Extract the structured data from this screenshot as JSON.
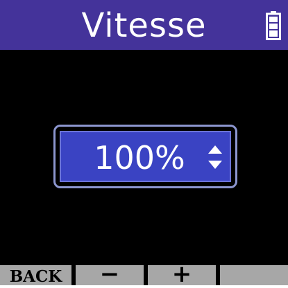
{
  "header": {
    "title": "Vitesse",
    "battery_icon": "battery-full-icon"
  },
  "main": {
    "value": "100%",
    "adjust_icon": "up-down-arrows-icon"
  },
  "softkeys": [
    {
      "label": "BACK"
    },
    {
      "label": "−"
    },
    {
      "label": "+"
    },
    {
      "label": ""
    }
  ],
  "colors": {
    "header_bg": "#44339a",
    "screen_bg": "#000000",
    "value_box_bg": "#3a43c3",
    "softkey_bg": "#a7a7a7",
    "text_light": "#ffffff"
  }
}
